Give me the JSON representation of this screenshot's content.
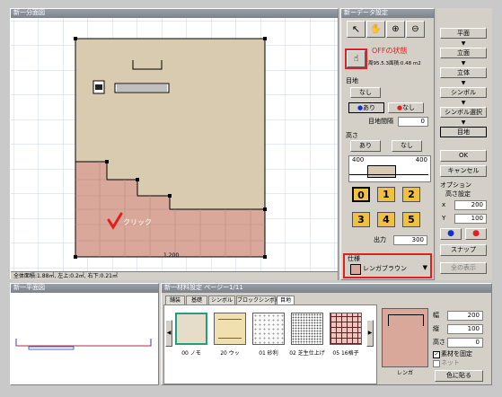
{
  "plan_window": {
    "title": "新一分面図",
    "status": "全体面積:1.88㎡, 左上:0.2㎡, 右下:0.21㎡",
    "dimension": "1.200"
  },
  "annotations": {
    "click_label": "クリック",
    "off_label": "OFFの状態"
  },
  "data_panel": {
    "title": "新ーデータ設定",
    "area_text": "周95.5.3面積:0.48 m2",
    "floor_group": "目地",
    "none_btn": "なし",
    "radio_yes": "あり",
    "radio_no": "なし",
    "joint_width_label": "目地間隔",
    "joint_width_value": "0",
    "height_group": "高さ",
    "height_yes": "あり",
    "height_no": "なし",
    "h_left": "400",
    "h_right": "400",
    "num_buttons": [
      "0",
      "1",
      "2",
      "3",
      "4",
      "5"
    ],
    "output_label": "出力",
    "output_value": "300",
    "material_group": "仕様",
    "material_value": "レンガブラウン"
  },
  "right_buttons": [
    "平面",
    "立面",
    "立体",
    "シンボル",
    "シンボル選択",
    "目地"
  ],
  "ok_label": "OK",
  "cancel_label": "キャンセル",
  "option": {
    "group": "オプション",
    "sub": "高さ設定",
    "x_label": "x",
    "x_value": "200",
    "y_label": "Y",
    "y_value": "100",
    "snap_label": "スナップ",
    "bottom_btn": "全の表示"
  },
  "mini_window": {
    "title": "新一平面図"
  },
  "material_window": {
    "title": "新一材料設定 ページー1/11",
    "tabs": [
      "舗装",
      "基礎",
      "シンボル",
      "ブロックシンボル",
      "目地"
    ],
    "thumbs": [
      "00 ノモ",
      "20 ウッ",
      "01 砂利",
      "02 芝生仕上げ",
      "05 16格子"
    ],
    "preview_caption": "レンガ",
    "w_label": "幅",
    "w_value": "200",
    "h_label": "縦",
    "h_value": "100",
    "d_label": "高さ",
    "d_value": "0",
    "check1": "素材を固定",
    "check2": "ネット",
    "apply_btn": "色に貼る"
  },
  "colors": {
    "floor_beige": "#d8cbb0",
    "brick": "#d9a89a",
    "accent_red": "#e02020"
  }
}
